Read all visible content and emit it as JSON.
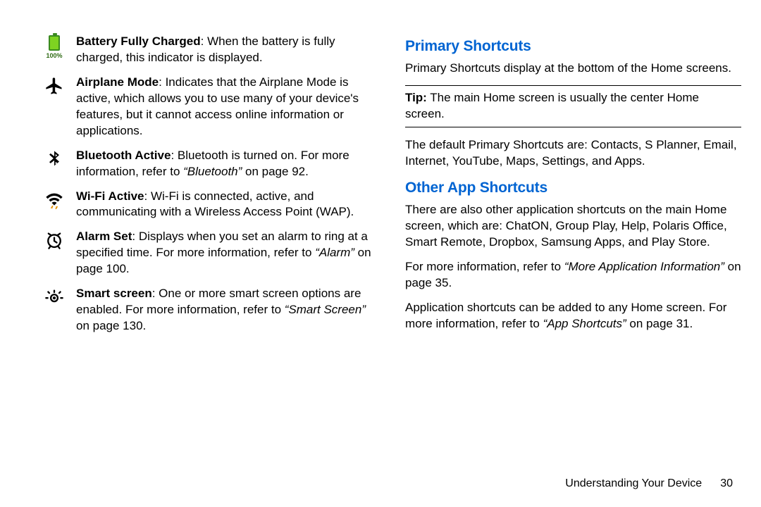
{
  "left": {
    "items": [
      {
        "icon": "battery",
        "pct": "100%",
        "term": "Battery Fully Charged",
        "desc": ": When the battery is fully charged, this indicator is displayed."
      },
      {
        "icon": "airplane",
        "term": "Airplane Mode",
        "desc": ": Indicates that the Airplane Mode is active, which allows you to use many of your device's features, but it cannot access online information or applications."
      },
      {
        "icon": "bluetooth",
        "term": "Bluetooth Active",
        "desc": ": Bluetooth is turned on. For more information, refer to ",
        "ref": "“Bluetooth”",
        "desc_after": " on page 92."
      },
      {
        "icon": "wifi",
        "term": "Wi-Fi Active",
        "desc": ": Wi-Fi is connected, active, and communicating with a Wireless Access Point (WAP)."
      },
      {
        "icon": "alarm",
        "term": "Alarm Set",
        "desc": ": Displays when you set an alarm to ring at a specified time. For more information, refer to ",
        "ref": "“Alarm”",
        "desc_after": " on page 100."
      },
      {
        "icon": "smart-screen",
        "term": "Smart screen",
        "desc": ": One or more smart screen options are enabled. For more information, refer to ",
        "ref": "“Smart Screen”",
        "desc_after": " on page 130."
      }
    ]
  },
  "right": {
    "h_primary": "Primary Shortcuts",
    "primary_intro": "Primary Shortcuts display at the bottom of the Home screens.",
    "tip_label": "Tip:",
    "tip_text": " The main Home screen is usually the center Home screen.",
    "primary_defaults": "The default Primary Shortcuts are: Contacts, S Planner, Email, Internet, YouTube, Maps, Settings, and Apps.",
    "h_other": "Other App Shortcuts",
    "other_intro": "There are also other application shortcuts on the main Home screen, which are: ChatON, Group Play, Help, Polaris Office, Smart Remote, Dropbox, Samsung Apps, and Play Store.",
    "other_more_pre": "For more information, refer to ",
    "other_more_ref": "“More Application Information”",
    "other_more_post": " on page 35.",
    "other_add_pre": "Application shortcuts can be added to any Home screen. For more information, refer to ",
    "other_add_ref": "“App Shortcuts”",
    "other_add_post": " on page 31."
  },
  "footer": {
    "section": "Understanding Your Device",
    "page": "30"
  }
}
